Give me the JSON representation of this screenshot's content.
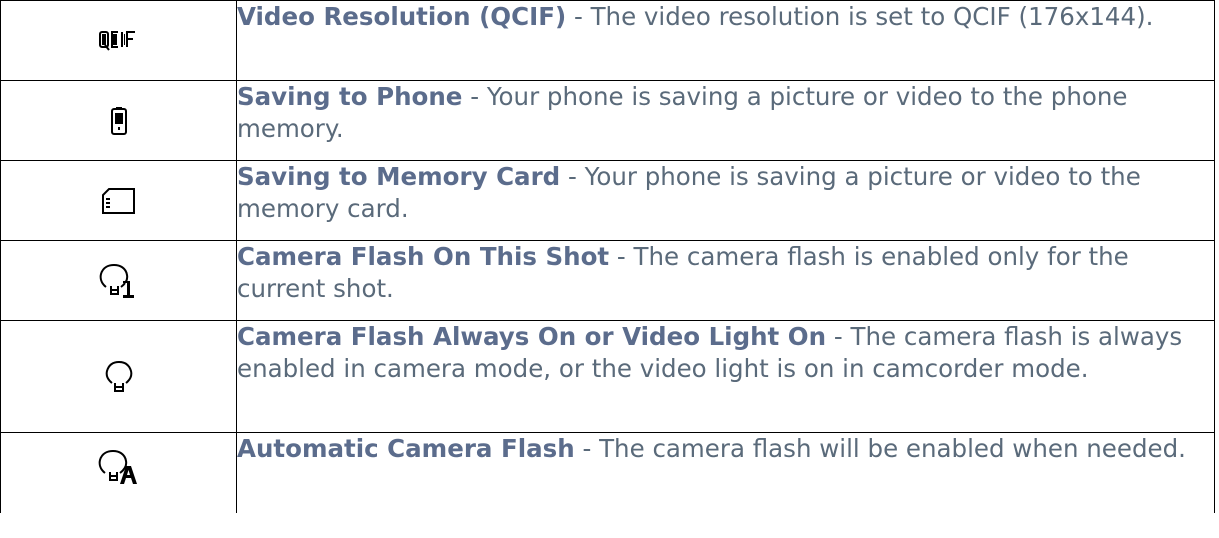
{
  "rows": [
    {
      "icon": "qcif-resolution-icon",
      "icon_text": "QCIF",
      "term": "Video Resolution (QCIF)",
      "description": " - The video resolution is set to QCIF (176x144)."
    },
    {
      "icon": "phone-memory-icon",
      "term": "Saving to Phone",
      "description": " - Your phone is saving a picture or video to the phone memory."
    },
    {
      "icon": "memory-card-icon",
      "term": "Saving to Memory Card",
      "description": " - Your phone is saving a picture or video to the memory card."
    },
    {
      "icon": "flash-this-shot-icon",
      "term": "Camera Flash On This Shot",
      "description": " - The camera flash is enabled only for the current shot."
    },
    {
      "icon": "flash-always-on-icon",
      "term": "Camera Flash Always On or Video Light On",
      "description": " - The camera flash is always enabled in camera mode, or the video light is on in camcorder mode."
    },
    {
      "icon": "flash-auto-icon",
      "term": "Automatic Camera Flash",
      "description": " - The camera flash will be enabled when needed."
    }
  ]
}
